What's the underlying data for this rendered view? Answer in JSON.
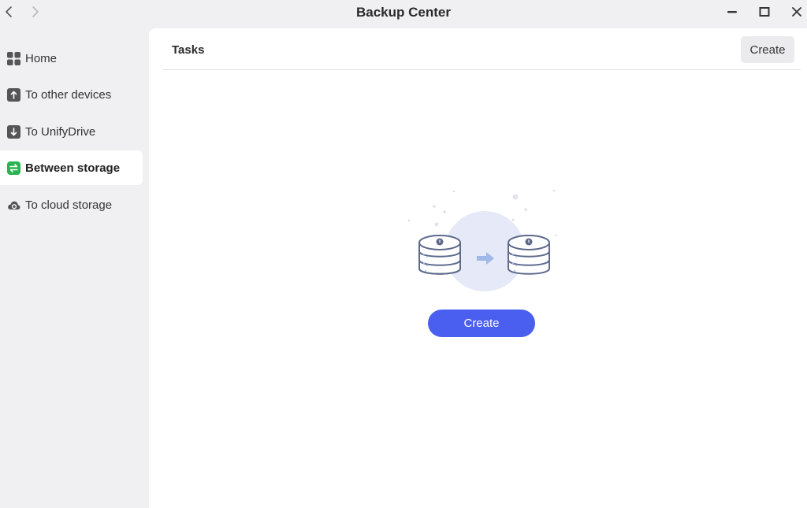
{
  "window": {
    "title": "Backup Center"
  },
  "sidebar": {
    "items": [
      {
        "label": "Home",
        "icon": "grid-icon"
      },
      {
        "label": "To other devices",
        "icon": "upload-arrow-icon"
      },
      {
        "label": "To UnifyDrive",
        "icon": "download-arrow-icon"
      },
      {
        "label": "Between storage",
        "icon": "swap-arrows-icon",
        "active": true
      },
      {
        "label": "To cloud storage",
        "icon": "cloud-icon"
      }
    ]
  },
  "main": {
    "title": "Tasks",
    "header_create_label": "Create",
    "empty_create_label": "Create"
  },
  "colors": {
    "accent": "#4a5ef0",
    "active_icon": "#2bb34f",
    "sidebar_bg": "#f0f0f3"
  }
}
